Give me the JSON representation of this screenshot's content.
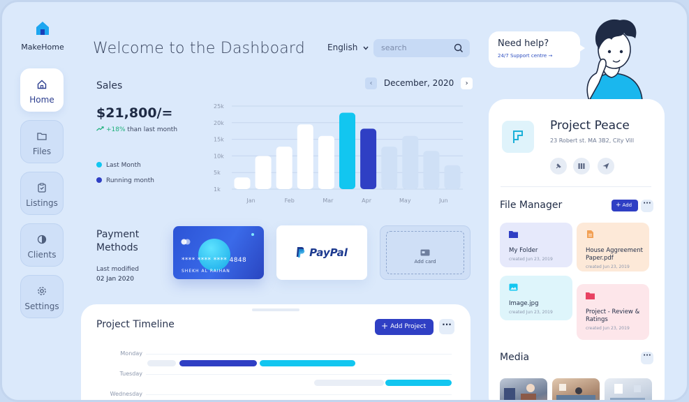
{
  "app": {
    "name": "MakeHome",
    "brand_color": "#2c54d6",
    "accent_cyan": "#12c6f0"
  },
  "sidebar": {
    "items": [
      {
        "label": "Home",
        "icon": "home-icon",
        "active": true
      },
      {
        "label": "Files",
        "icon": "folder-icon"
      },
      {
        "label": "Listings",
        "icon": "clipboard-icon"
      },
      {
        "label": "Clients",
        "icon": "clients-icon"
      },
      {
        "label": "Settings",
        "icon": "gear-icon"
      }
    ]
  },
  "header": {
    "title": "Welcome to the Dashboard",
    "language": "English",
    "search_placeholder": "search"
  },
  "sales": {
    "title": "Sales",
    "amount": "$21,800/=",
    "change": "+18%",
    "change_text": "than last month",
    "legend": [
      {
        "label": "Last Month",
        "color": "#12c6f0"
      },
      {
        "label": "Running month",
        "color": "#2f3fc4"
      }
    ],
    "period": "December, 2020"
  },
  "chart_data": {
    "type": "bar",
    "categories": [
      "Jan",
      "Feb",
      "Mar",
      "Apr",
      "May",
      "Jun"
    ],
    "y_ticks": [
      "25k",
      "20k",
      "15k",
      "10k",
      "5k",
      "1k"
    ],
    "ylim": [
      0,
      25000
    ],
    "bars": [
      {
        "value": 3500,
        "color": "#ffffff"
      },
      {
        "value": 10000,
        "color": "#ffffff"
      },
      {
        "value": 12800,
        "color": "#ffffff"
      },
      {
        "value": 19500,
        "color": "#ffffff"
      },
      {
        "value": 16000,
        "color": "#ffffff"
      },
      {
        "value": 23000,
        "color": "#12c6f0"
      },
      {
        "value": 18200,
        "color": "#2f3fc4"
      },
      {
        "value": 12800,
        "color": "#cfe0f6"
      },
      {
        "value": 16000,
        "color": "#cfe0f6"
      },
      {
        "value": 11500,
        "color": "#cfe0f6"
      },
      {
        "value": 7200,
        "color": "#cfe0f6"
      }
    ]
  },
  "payment": {
    "title_line1": "Payment",
    "title_line2": "Methods",
    "modified_label": "Last modified",
    "modified_date": "02 Jan 2020",
    "card_number": "**** **** **** 4848",
    "card_holder": "SHEKH AL RAIHAN",
    "paypal_label": "PayPal",
    "add_card_label": "Add card"
  },
  "timeline": {
    "title": "Project Timeline",
    "add_label": "Add Project",
    "days": [
      "Monday",
      "Tuesday",
      "Wednesday"
    ]
  },
  "help": {
    "title": "Need help?",
    "link": "24/7 Support centre"
  },
  "project": {
    "name": "Project Peace",
    "address": "23 Robert st. MA 3B2, City Vill"
  },
  "file_manager": {
    "title": "File Manager",
    "add_label": "Add",
    "files": [
      {
        "name": "My Folder",
        "date": "created Jun 23, 2019",
        "color": "#e6e9fb",
        "icon_color": "#2f3fc4"
      },
      {
        "name": "House Aggreement Paper.pdf",
        "date": "created Jun 23, 2019",
        "color": "#fde9d8",
        "icon_color": "#f2a054"
      },
      {
        "name": "Image.jpg",
        "date": "created Jun 23, 2019",
        "color": "#def5fb",
        "icon_color": "#12c6f0"
      },
      {
        "name": "Project - Review & Ratings",
        "date": "created Jun 23, 2019",
        "color": "#fde6ea",
        "icon_color": "#e84262"
      }
    ]
  },
  "media": {
    "title": "Media"
  }
}
